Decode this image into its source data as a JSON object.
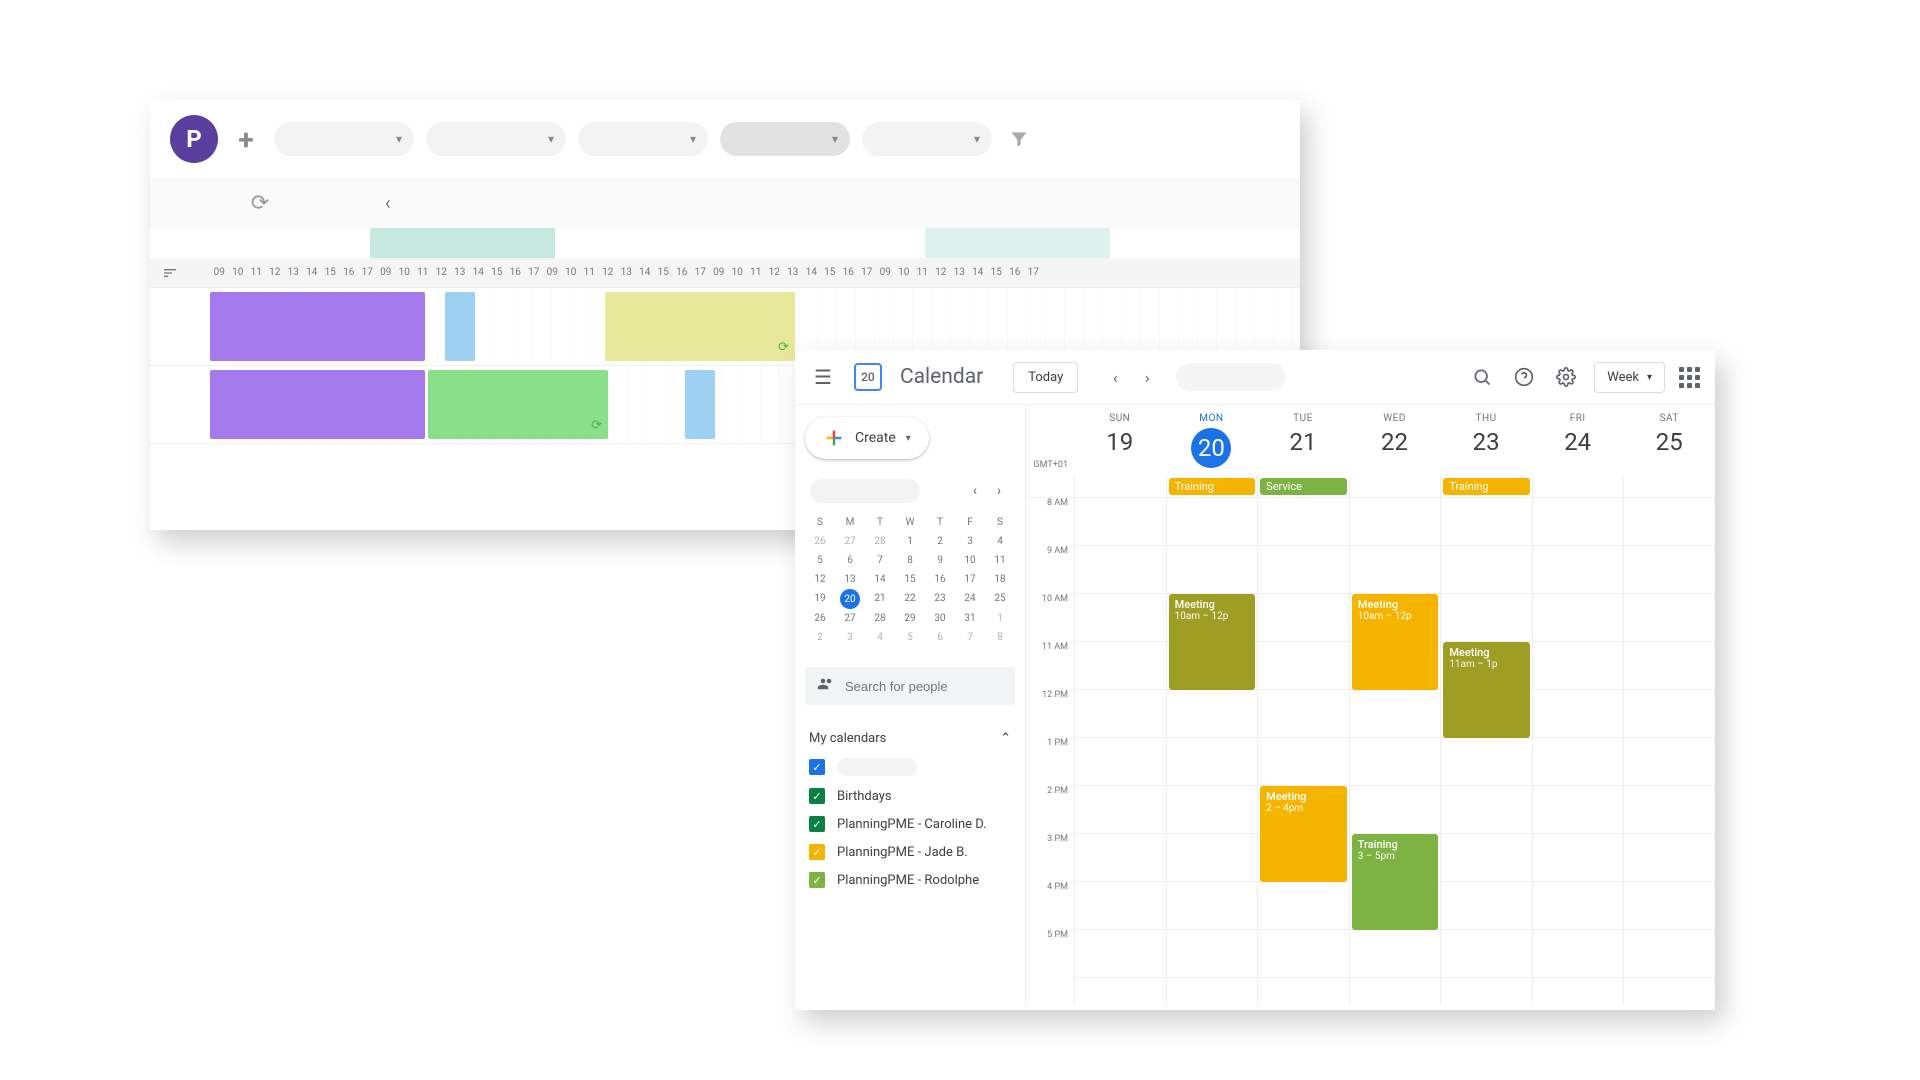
{
  "pme": {
    "hours": [
      "09",
      "10",
      "11",
      "12",
      "13",
      "14",
      "15",
      "16",
      "17",
      "09",
      "10",
      "11",
      "12",
      "13",
      "14",
      "15",
      "16",
      "17",
      "09",
      "10",
      "11",
      "12",
      "13",
      "14",
      "15",
      "16",
      "17",
      "09",
      "10",
      "11",
      "12",
      "13",
      "14",
      "15",
      "16",
      "17",
      "09",
      "10",
      "11",
      "12",
      "13",
      "14",
      "15",
      "16",
      "17"
    ]
  },
  "gcal": {
    "app_title": "Calendar",
    "logo_day": "20",
    "today_label": "Today",
    "view_label": "Week",
    "timezone": "GMT+01",
    "days": [
      {
        "name": "SUN",
        "num": "19"
      },
      {
        "name": "MON",
        "num": "20",
        "selected": true
      },
      {
        "name": "TUE",
        "num": "21"
      },
      {
        "name": "WED",
        "num": "22"
      },
      {
        "name": "THU",
        "num": "23"
      },
      {
        "name": "FRI",
        "num": "24"
      },
      {
        "name": "SAT",
        "num": "25"
      }
    ],
    "hours": [
      "8 AM",
      "9 AM",
      "10 AM",
      "11 AM",
      "12 PM",
      "1 PM",
      "2 PM",
      "3 PM",
      "4 PM",
      "5 PM"
    ],
    "create_label": "Create",
    "search_placeholder": "Search for people",
    "my_calendars_label": "My calendars",
    "mini_dh": [
      "S",
      "M",
      "T",
      "W",
      "T",
      "F",
      "S"
    ],
    "mini_rows": [
      [
        "26",
        "27",
        "28",
        "1",
        "2",
        "3",
        "4"
      ],
      [
        "5",
        "6",
        "7",
        "8",
        "9",
        "10",
        "11"
      ],
      [
        "12",
        "13",
        "14",
        "15",
        "16",
        "17",
        "18"
      ],
      [
        "19",
        "20",
        "21",
        "22",
        "23",
        "24",
        "25"
      ],
      [
        "26",
        "27",
        "28",
        "29",
        "30",
        "31",
        "1"
      ],
      [
        "2",
        "3",
        "4",
        "5",
        "6",
        "7",
        "8"
      ]
    ],
    "calendars": [
      {
        "label": "",
        "placeholder": true,
        "color": "#1a73e8"
      },
      {
        "label": "Birthdays",
        "color": "#0b8043"
      },
      {
        "label": "PlanningPME - Caroline D.",
        "color": "#0b8043"
      },
      {
        "label": "PlanningPME - Jade B.",
        "color": "#f4b400"
      },
      {
        "label": "PlanningPME - Rodolphe",
        "color": "#7cb342"
      }
    ],
    "allday": [
      {
        "day": 1,
        "label": "Training",
        "cls": "orange"
      },
      {
        "day": 2,
        "label": "Service",
        "cls": "green"
      },
      {
        "day": 4,
        "label": "Training",
        "cls": "orange"
      }
    ],
    "events": {
      "mon_meeting_title": "Meeting",
      "mon_meeting_time": "10am – 12p",
      "tue_meeting_title": "Meeting",
      "tue_meeting_time": "2 – 4pm",
      "wed_meeting_title": "Meeting",
      "wed_meeting_time": "10am – 12p",
      "wed_training_title": "Training",
      "wed_training_time": "3 – 5pm",
      "thu_meeting_title": "Meeting",
      "thu_meeting_time": "11am – 1p"
    }
  }
}
